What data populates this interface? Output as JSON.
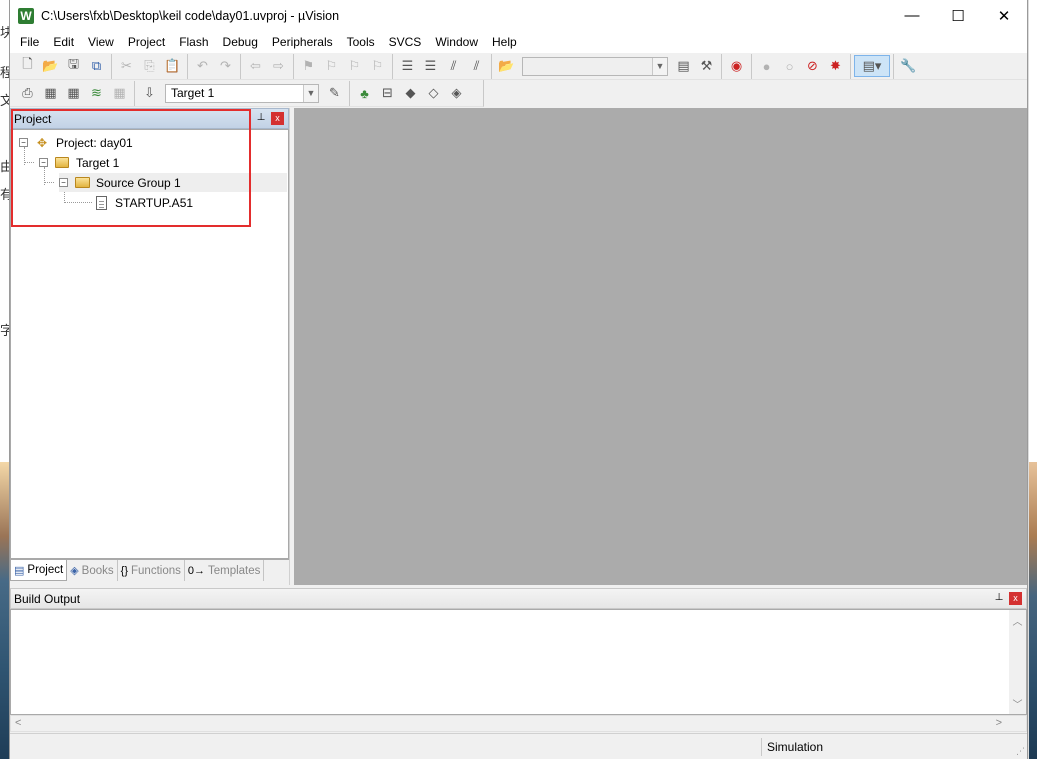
{
  "window": {
    "title": "C:\\Users\\fxb\\Desktop\\keil code\\day01.uvproj - µVision",
    "app_icon_letter": "W",
    "minimize": "—",
    "maximize": "☐",
    "close": "✕"
  },
  "menu": [
    "File",
    "Edit",
    "View",
    "Project",
    "Flash",
    "Debug",
    "Peripherals",
    "Tools",
    "SVCS",
    "Window",
    "Help"
  ],
  "toolbar2": {
    "target_select": "Target 1"
  },
  "project_panel": {
    "title": "Project",
    "pin": "⊥",
    "close": "x",
    "tree": {
      "project": "Project: day01",
      "target": "Target 1",
      "group": "Source Group 1",
      "file": "STARTUP.A51"
    },
    "tabs": [
      {
        "label": "Project",
        "icon": "▤"
      },
      {
        "label": "Books",
        "icon": "◈"
      },
      {
        "label": "Functions",
        "icon": "{}"
      },
      {
        "label": "Templates",
        "icon": "0→"
      }
    ]
  },
  "build_output": {
    "title": "Build Output",
    "pin": "⊥",
    "close": "x"
  },
  "status": {
    "mode": "Simulation"
  },
  "colors": {
    "highlight": "#e32d2d",
    "editor_bg": "#ababab"
  }
}
